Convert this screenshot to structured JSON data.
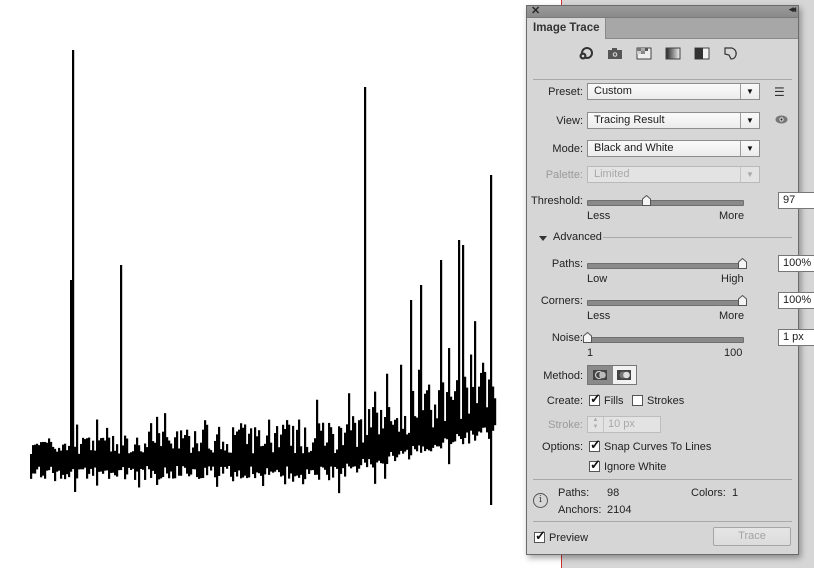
{
  "canvas": {
    "description": "Traced black and white spectrum-like signal artwork",
    "artboard_edge_color": "#d0312d",
    "pasteboard_color": "#d6d6d6"
  },
  "panel": {
    "title": "Image Trace",
    "close_icon": "close-icon",
    "collapse_icon": "collapse-double-arrow-icon",
    "preset_icons": [
      {
        "name": "auto-color-icon"
      },
      {
        "name": "high-color-icon"
      },
      {
        "name": "low-color-icon"
      },
      {
        "name": "grayscale-icon"
      },
      {
        "name": "black-and-white-icon"
      },
      {
        "name": "outline-icon"
      }
    ],
    "preset": {
      "label": "Preset:",
      "value": "Custom",
      "menu_icon": "list-menu-icon"
    },
    "view": {
      "label": "View:",
      "value": "Tracing Result",
      "eye_icon": "eye-icon"
    },
    "mode": {
      "label": "Mode:",
      "value": "Black and White"
    },
    "palette": {
      "label": "Palette:",
      "value": "Limited",
      "disabled": true
    },
    "threshold": {
      "label": "Threshold:",
      "value": "97",
      "min_label": "Less",
      "max_label": "More",
      "fraction": 0.38
    },
    "advanced": {
      "label": "Advanced",
      "expanded": true
    },
    "paths": {
      "label": "Paths:",
      "value": "100%",
      "min_label": "Low",
      "max_label": "High",
      "fraction": 1.0
    },
    "corners": {
      "label": "Corners:",
      "value": "100%",
      "min_label": "Less",
      "max_label": "More",
      "fraction": 1.0
    },
    "noise": {
      "label": "Noise:",
      "value": "1 px",
      "min_label": "1",
      "max_label": "100",
      "fraction": 0.0
    },
    "method": {
      "label": "Method:",
      "options": [
        "Abutting",
        "Overlapping"
      ],
      "selected": "Abutting"
    },
    "create": {
      "label": "Create:",
      "fills_label": "Fills",
      "fills_checked": true,
      "strokes_label": "Strokes",
      "strokes_checked": false
    },
    "stroke": {
      "label": "Stroke:",
      "value": "10 px",
      "disabled": true
    },
    "options": {
      "label": "Options:",
      "snap_label": "Snap Curves To Lines",
      "snap_checked": true,
      "ignore_white_label": "Ignore White",
      "ignore_white_checked": true
    },
    "info": {
      "paths_label": "Paths:",
      "paths_value": "98",
      "colors_label": "Colors:",
      "colors_value": "1",
      "anchors_label": "Anchors:",
      "anchors_value": "2104"
    },
    "preview": {
      "label": "Preview",
      "checked": true
    },
    "trace_button": {
      "label": "Trace",
      "disabled": true
    }
  }
}
